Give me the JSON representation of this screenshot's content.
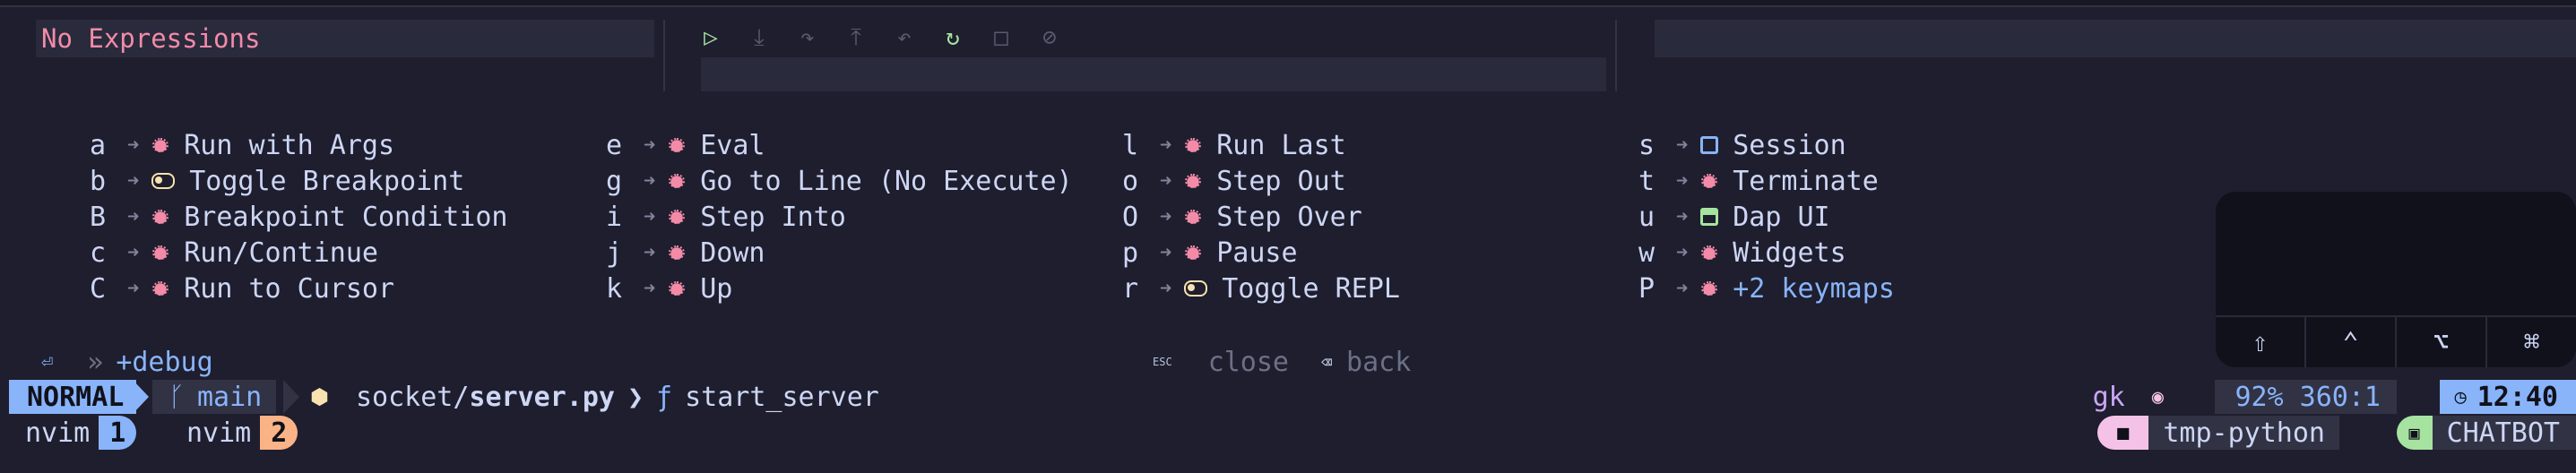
{
  "dapui": {
    "expressions_placeholder": "No Expressions",
    "controls": [
      {
        "name": "play-icon",
        "glyph": "▷",
        "color": "#a6e3a1"
      },
      {
        "name": "step-into-icon",
        "glyph": "⤓",
        "color": "#585b70"
      },
      {
        "name": "step-over-icon",
        "glyph": "↷",
        "color": "#585b70"
      },
      {
        "name": "step-out-icon",
        "glyph": "⤒",
        "color": "#585b70"
      },
      {
        "name": "step-back-icon",
        "glyph": "↶",
        "color": "#585b70"
      },
      {
        "name": "restart-icon",
        "glyph": "↻",
        "color": "#a6e3a1"
      },
      {
        "name": "stop-icon",
        "glyph": "□",
        "color": "#585b70"
      },
      {
        "name": "disconnect-icon",
        "glyph": "⊘",
        "color": "#585b70"
      }
    ]
  },
  "whichkey": {
    "columns": [
      [
        {
          "key": "a",
          "icon": "bug-icon",
          "label": "Run with Args"
        },
        {
          "key": "b",
          "icon": "toggle-icon",
          "label": "Toggle Breakpoint"
        },
        {
          "key": "B",
          "icon": "bug-icon",
          "label": "Breakpoint Condition"
        },
        {
          "key": "c",
          "icon": "bug-icon",
          "label": "Run/Continue"
        },
        {
          "key": "C",
          "icon": "bug-icon",
          "label": "Run to Cursor"
        }
      ],
      [
        {
          "key": "e",
          "icon": "bug-icon",
          "label": "Eval"
        },
        {
          "key": "g",
          "icon": "bug-icon",
          "label": "Go to Line (No Execute)"
        },
        {
          "key": "i",
          "icon": "bug-icon",
          "label": "Step Into"
        },
        {
          "key": "j",
          "icon": "bug-icon",
          "label": "Down"
        },
        {
          "key": "k",
          "icon": "bug-icon",
          "label": "Up"
        }
      ],
      [
        {
          "key": "l",
          "icon": "bug-icon",
          "label": "Run Last"
        },
        {
          "key": "o",
          "icon": "bug-icon",
          "label": "Step Out"
        },
        {
          "key": "O",
          "icon": "bug-icon",
          "label": "Step Over"
        },
        {
          "key": "p",
          "icon": "bug-icon",
          "label": "Pause"
        },
        {
          "key": "r",
          "icon": "toggle-icon",
          "label": "Toggle REPL"
        }
      ],
      [
        {
          "key": "s",
          "icon": "session-icon",
          "label": "Session"
        },
        {
          "key": "t",
          "icon": "bug-icon",
          "label": "Terminate"
        },
        {
          "key": "u",
          "icon": "ui-icon",
          "label": "Dap UI"
        },
        {
          "key": "w",
          "icon": "bug-icon",
          "label": "Widgets"
        },
        {
          "key": "P",
          "icon": "bug-icon",
          "label": "+2 keymaps",
          "accent": true
        }
      ]
    ],
    "breadcrumb": {
      "sep": "»",
      "group": "+debug"
    },
    "footer": {
      "esc_key": "ESC",
      "close_label": "close",
      "back_label": "back"
    }
  },
  "keypad": {
    "keys": [
      {
        "name": "shift-key-icon",
        "glyph": "⇧"
      },
      {
        "name": "ctrl-key-icon",
        "glyph": "⌃"
      },
      {
        "name": "option-key-icon",
        "glyph": "⌥"
      },
      {
        "name": "command-key-icon",
        "glyph": "⌘"
      }
    ]
  },
  "statusline": {
    "mode": "NORMAL",
    "branch": "main",
    "file_dir": "socket/",
    "file_name": "server.py",
    "breadcrumb_sep": "❯",
    "function_icon": "ƒ",
    "function": "start_server",
    "user": "gk",
    "position": "92% 360:1",
    "time": "12:40"
  },
  "tmux": {
    "windows": [
      {
        "name": "nvim",
        "index": "1",
        "color": "#89b4fa"
      },
      {
        "name": "nvim",
        "index": "2",
        "color": "#fab387"
      }
    ],
    "session": "tmp-python",
    "app": "CHATBOT"
  },
  "colors": {
    "background": "#1e1e2e",
    "accent_blue": "#89b4fa",
    "bug_red": "#f38ba8",
    "yellow": "#f9e2af",
    "green": "#a6e3a1"
  }
}
